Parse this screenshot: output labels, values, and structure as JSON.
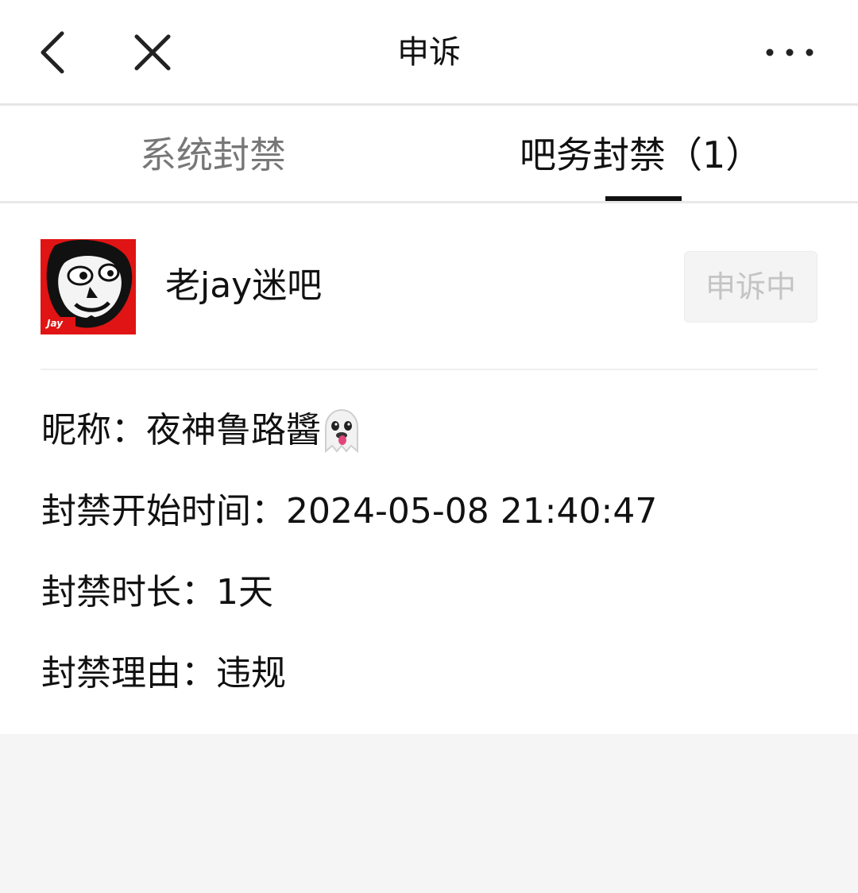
{
  "header": {
    "title": "申诉",
    "back_icon": "chevron-left-icon",
    "close_icon": "close-icon",
    "more_icon": "more-dots-icon"
  },
  "tabs": [
    {
      "label": "系统封禁",
      "active": false
    },
    {
      "label": "吧务封禁（1）",
      "active": true
    }
  ],
  "forum": {
    "name": "老jay迷吧",
    "avatar_icon": "forum-avatar-image",
    "status": "申诉中"
  },
  "details": {
    "nickname_label": "昵称：",
    "nickname_value": "夜神鲁路醬",
    "nickname_emoji": "ghost-emoji-icon",
    "start_label": "封禁开始时间：",
    "start_value": "2024-05-08 21:40:47",
    "duration_label": "封禁时长：",
    "duration_value": "1天",
    "reason_label": "封禁理由：",
    "reason_value": "违规"
  },
  "colors": {
    "tab_inactive": "#777777",
    "tab_active": "#111111",
    "status_text": "#c4c4c4",
    "avatar_bg": "#e01414"
  }
}
